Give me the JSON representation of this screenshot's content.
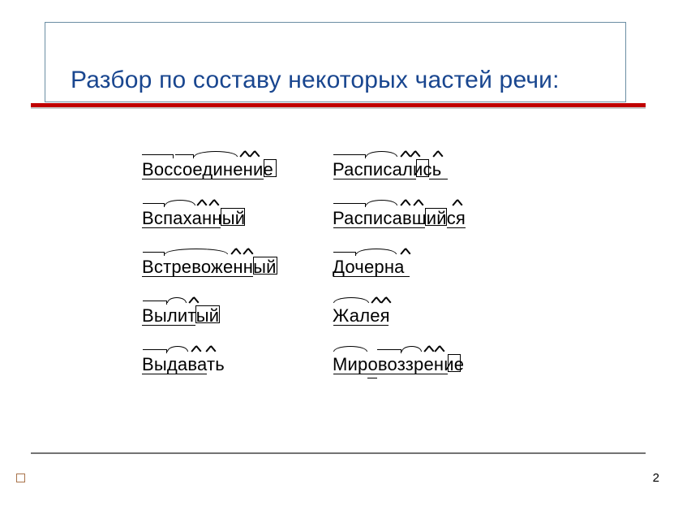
{
  "title": "Разбор по составу некоторых частей речи:",
  "page_number": "2",
  "words": {
    "r1c1": "Воссоединение",
    "r1c2": "Расписались",
    "r2c1": "Вспаханный",
    "r2c2": "Расписавшийся",
    "r3c1": "Встревоженный",
    "r3c2": "Дочерна",
    "r4c1": "Вылитый",
    "r4c2": "Жалея",
    "r5c1": "Выдавать",
    "r5c2": "Мировоззрение"
  }
}
